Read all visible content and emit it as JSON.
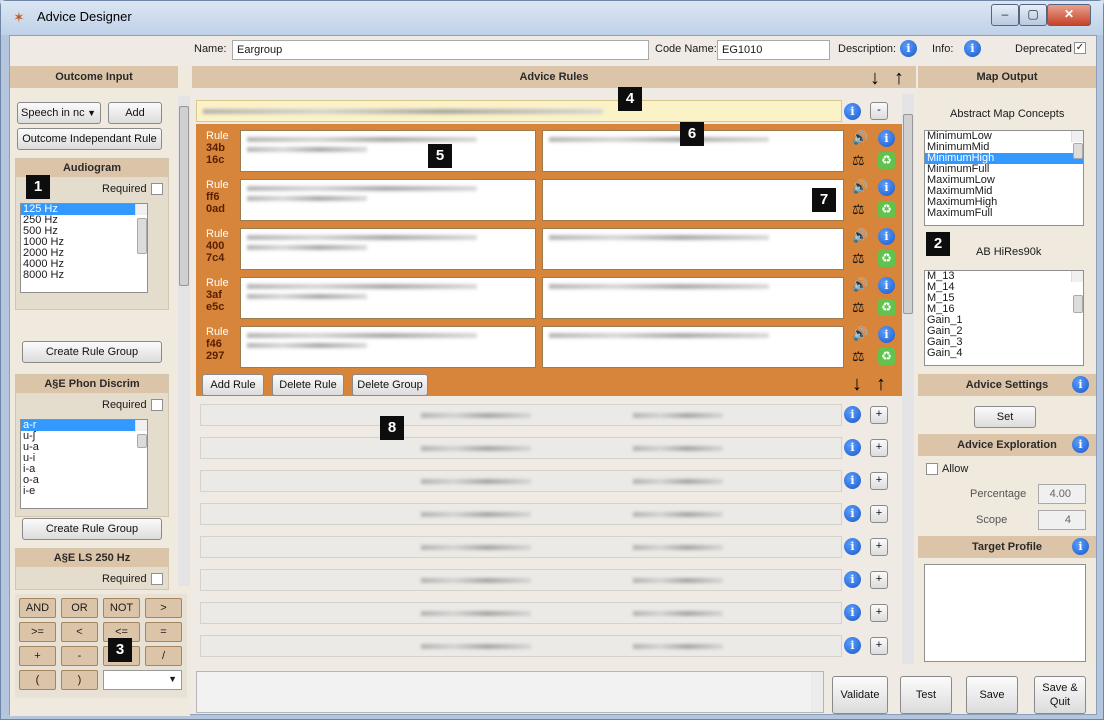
{
  "window": {
    "title": "Advice Designer",
    "min": "–",
    "max": "▢",
    "close": "✕"
  },
  "top": {
    "name_label": "Name:",
    "name_value": "Eargroup",
    "code_label": "Code Name:",
    "code_value": "EG1010",
    "desc_label": "Description:",
    "info_label": "Info:",
    "deprecated_label": "Deprecated",
    "deprecated_checked": true
  },
  "outcome": {
    "header": "Outcome Input",
    "dropdown": "Speech in nc",
    "add": "Add",
    "independent": "Outcome Independant Rule",
    "groups": [
      {
        "title": "Audiogram",
        "required": "Required",
        "items": [
          "125 Hz",
          "250 Hz",
          "500 Hz",
          "1000 Hz",
          "2000 Hz",
          "4000 Hz",
          "8000 Hz"
        ],
        "create": "Create Rule Group"
      },
      {
        "title": "A§E Phon Discrim",
        "required": "Required",
        "items": [
          "a-r",
          "u-ʃ",
          "u-a",
          "u-i",
          "i-a",
          "o-a",
          "i-e"
        ],
        "create": "Create Rule Group"
      },
      {
        "title": "A§E LS 250 Hz",
        "required": "Required"
      }
    ],
    "ops": [
      "AND",
      "OR",
      "NOT",
      ">",
      ">=",
      "<",
      "<=",
      "=",
      "+",
      "-",
      "*",
      "/",
      "(",
      ")"
    ]
  },
  "rules": {
    "header": "Advice Rules",
    "rule_label": "Rule",
    "ids": [
      [
        "34b",
        "16c"
      ],
      [
        "ff6",
        "0ad"
      ],
      [
        "400",
        "7c4"
      ],
      [
        "3af",
        "e5c"
      ],
      [
        "f46",
        "297"
      ]
    ],
    "add_rule": "Add Rule",
    "delete_rule": "Delete Rule",
    "delete_group": "Delete Group",
    "minus": "-",
    "plus": "+"
  },
  "map": {
    "header": "Map Output",
    "abstract": "Abstract Map Concepts",
    "concepts": [
      "MinimumLow",
      "MinimumMid",
      "MinimumHigh",
      "MinimumFull",
      "MaximumLow",
      "MaximumMid",
      "MaximumHigh",
      "MaximumFull"
    ],
    "device": "AB HiRes90k",
    "params": [
      "M_13",
      "M_14",
      "M_15",
      "M_16",
      "Gain_1",
      "Gain_2",
      "Gain_3",
      "Gain_4"
    ],
    "settings": "Advice Settings",
    "set": "Set",
    "exploration": "Advice Exploration",
    "allow": "Allow",
    "percentage_label": "Percentage",
    "percentage": "4.00",
    "scope_label": "Scope",
    "scope": "4",
    "target": "Target Profile"
  },
  "bottom": {
    "validate": "Validate",
    "test": "Test",
    "save": "Save",
    "save_quit": "Save & Quit"
  },
  "callouts": [
    "1",
    "2",
    "3",
    "4",
    "5",
    "6",
    "7",
    "8"
  ],
  "icons": {
    "info": "i",
    "speaker": "🔊",
    "weight": "⚖",
    "recycle": "♻",
    "down": "↓",
    "up": "↑"
  }
}
